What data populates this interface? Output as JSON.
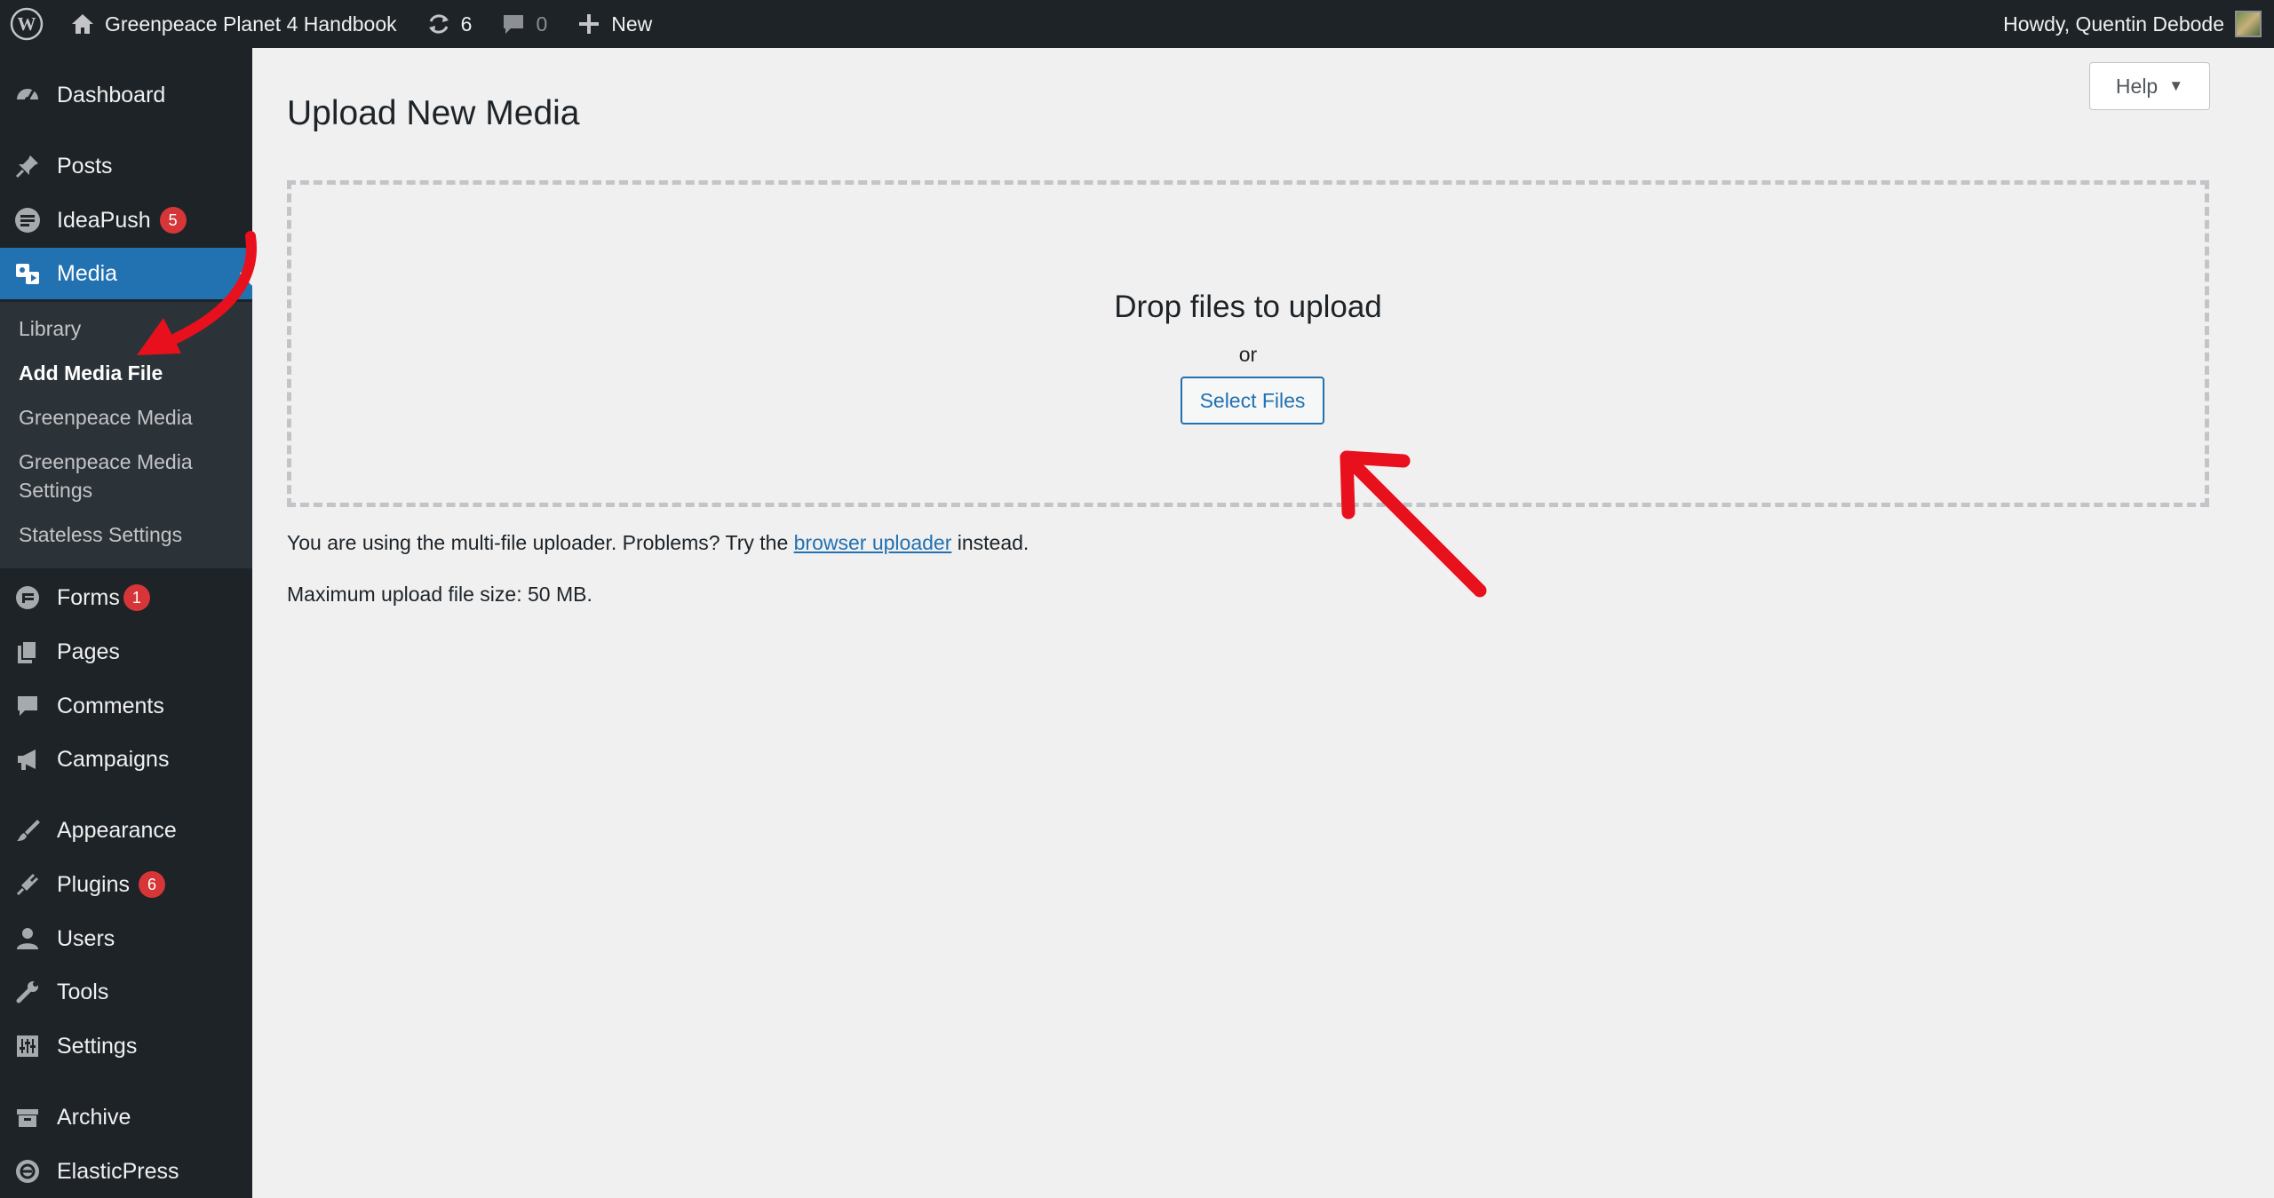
{
  "admin_bar": {
    "site_name": "Greenpeace Planet 4 Handbook",
    "updates_count": "6",
    "comments_count": "0",
    "new_label": "New",
    "greeting": "Howdy, Quentin Debode"
  },
  "sidebar": {
    "items": [
      {
        "label": "Dashboard",
        "icon": "dashboard-icon"
      },
      {
        "label": "Posts",
        "icon": "pin-icon"
      },
      {
        "label": "IdeaPush",
        "icon": "ideapush-icon",
        "badge": "5"
      },
      {
        "label": "Media",
        "icon": "media-icon",
        "current": true
      },
      {
        "label": "Forms",
        "icon": "forms-icon",
        "badge": "1"
      },
      {
        "label": "Pages",
        "icon": "pages-icon"
      },
      {
        "label": "Comments",
        "icon": "comment-icon"
      },
      {
        "label": "Campaigns",
        "icon": "megaphone-icon"
      },
      {
        "label": "Appearance",
        "icon": "brush-icon"
      },
      {
        "label": "Plugins",
        "icon": "plugin-icon",
        "badge": "6"
      },
      {
        "label": "Users",
        "icon": "user-icon"
      },
      {
        "label": "Tools",
        "icon": "wrench-icon"
      },
      {
        "label": "Settings",
        "icon": "settings-icon"
      },
      {
        "label": "Archive",
        "icon": "archive-icon"
      },
      {
        "label": "ElasticPress",
        "icon": "elasticpress-icon"
      }
    ],
    "submenu": [
      {
        "label": "Library"
      },
      {
        "label": "Add Media File",
        "current": true
      },
      {
        "label": "Greenpeace Media"
      },
      {
        "label": "Greenpeace Media Settings"
      },
      {
        "label": "Stateless Settings"
      }
    ]
  },
  "help_label": "Help",
  "page_title": "Upload New Media",
  "uploader": {
    "drop_title": "Drop files to upload",
    "or_label": "or",
    "select_button": "Select Files"
  },
  "info": {
    "multi_prefix": "You are using the multi-file uploader. Problems? Try the",
    "browser_link": "browser uploader",
    "multi_suffix": "instead.",
    "max_size": "Maximum upload file size: 50 MB."
  },
  "colors": {
    "accent": "#2271b1",
    "sidebar_bg": "#1d2327",
    "submenu_bg": "#2c3338",
    "badge": "#d63638",
    "annotation_arrow": "#e8101c"
  }
}
